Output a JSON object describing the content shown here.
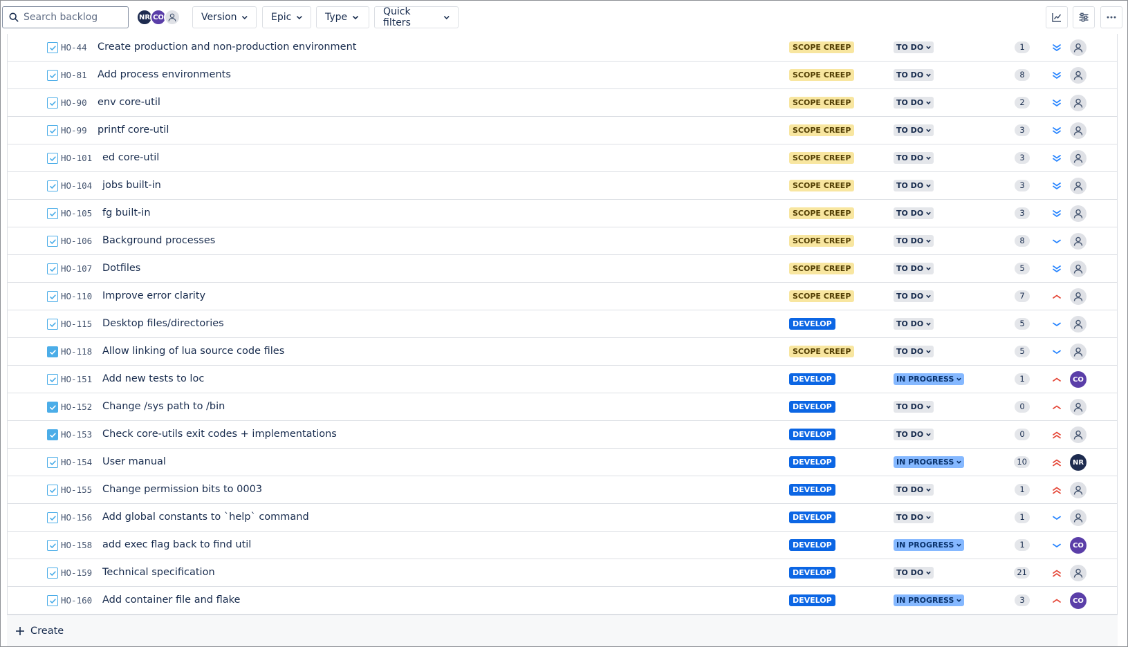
{
  "toolbar": {
    "search_placeholder": "Search backlog",
    "avatars": [
      "NR",
      "CO",
      "unassigned"
    ],
    "filters": {
      "version": "Version",
      "epic": "Epic",
      "type": "Type",
      "quick": "Quick filters"
    },
    "buttons": [
      "insights-icon",
      "view-settings-icon",
      "more-icon"
    ]
  },
  "colors": {
    "scope_creep_bg": "#f8e6a0",
    "develop_bg": "#0c66e4",
    "in_progress_bg": "#85b8ff",
    "todo_bg": "#e4e6ea",
    "priority_low": "#2684ff",
    "priority_high": "#e5493a"
  },
  "issues": [
    {
      "key": "HO-44",
      "summary": "Create production and non-production environment",
      "epic": "SCOPE CREEP",
      "status": "TO DO",
      "points": "1",
      "priority": "lowest",
      "assignee": "",
      "checked": false
    },
    {
      "key": "HO-81",
      "summary": "Add process environments",
      "epic": "SCOPE CREEP",
      "status": "TO DO",
      "points": "8",
      "priority": "lowest",
      "assignee": "",
      "checked": false
    },
    {
      "key": "HO-90",
      "summary": "env core-util",
      "epic": "SCOPE CREEP",
      "status": "TO DO",
      "points": "2",
      "priority": "lowest",
      "assignee": "",
      "checked": false
    },
    {
      "key": "HO-99",
      "summary": "printf core-util",
      "epic": "SCOPE CREEP",
      "status": "TO DO",
      "points": "3",
      "priority": "lowest",
      "assignee": "",
      "checked": false
    },
    {
      "key": "HO-101",
      "summary": "ed core-util",
      "epic": "SCOPE CREEP",
      "status": "TO DO",
      "points": "3",
      "priority": "lowest",
      "assignee": "",
      "checked": false
    },
    {
      "key": "HO-104",
      "summary": "jobs built-in",
      "epic": "SCOPE CREEP",
      "status": "TO DO",
      "points": "3",
      "priority": "lowest",
      "assignee": "",
      "checked": false
    },
    {
      "key": "HO-105",
      "summary": "fg built-in",
      "epic": "SCOPE CREEP",
      "status": "TO DO",
      "points": "3",
      "priority": "lowest",
      "assignee": "",
      "checked": false
    },
    {
      "key": "HO-106",
      "summary": "Background processes",
      "epic": "SCOPE CREEP",
      "status": "TO DO",
      "points": "8",
      "priority": "low",
      "assignee": "",
      "checked": false
    },
    {
      "key": "HO-107",
      "summary": "Dotfiles",
      "epic": "SCOPE CREEP",
      "status": "TO DO",
      "points": "5",
      "priority": "lowest",
      "assignee": "",
      "checked": false
    },
    {
      "key": "HO-110",
      "summary": "Improve error clarity",
      "epic": "SCOPE CREEP",
      "status": "TO DO",
      "points": "7",
      "priority": "high",
      "assignee": "",
      "checked": false
    },
    {
      "key": "HO-115",
      "summary": "Desktop files/directories",
      "epic": "DEVELOP",
      "status": "TO DO",
      "points": "5",
      "priority": "low",
      "assignee": "",
      "checked": false
    },
    {
      "key": "HO-118",
      "summary": "Allow linking of lua source code files",
      "epic": "SCOPE CREEP",
      "status": "TO DO",
      "points": "5",
      "priority": "low",
      "assignee": "",
      "checked": true
    },
    {
      "key": "HO-151",
      "summary": "Add new tests to loc",
      "epic": "DEVELOP",
      "status": "IN PROGRESS",
      "points": "1",
      "priority": "high",
      "assignee": "CO",
      "checked": false
    },
    {
      "key": "HO-152",
      "summary": "Change /sys path to /bin",
      "epic": "DEVELOP",
      "status": "TO DO",
      "points": "0",
      "priority": "high",
      "assignee": "",
      "checked": true
    },
    {
      "key": "HO-153",
      "summary": "Check core-utils exit codes + implementations",
      "epic": "DEVELOP",
      "status": "TO DO",
      "points": "0",
      "priority": "highest",
      "assignee": "",
      "checked": true
    },
    {
      "key": "HO-154",
      "summary": "User manual",
      "epic": "DEVELOP",
      "status": "IN PROGRESS",
      "points": "10",
      "priority": "highest",
      "assignee": "NR",
      "checked": false
    },
    {
      "key": "HO-155",
      "summary": "Change permission bits to 0003",
      "epic": "DEVELOP",
      "status": "TO DO",
      "points": "1",
      "priority": "highest",
      "assignee": "",
      "checked": false
    },
    {
      "key": "HO-156",
      "summary": "Add global constants to `help` command",
      "epic": "DEVELOP",
      "status": "TO DO",
      "points": "1",
      "priority": "low",
      "assignee": "",
      "checked": false
    },
    {
      "key": "HO-158",
      "summary": "add exec flag back to find util",
      "epic": "DEVELOP",
      "status": "IN PROGRESS",
      "points": "1",
      "priority": "low",
      "assignee": "CO",
      "checked": false
    },
    {
      "key": "HO-159",
      "summary": "Technical specification",
      "epic": "DEVELOP",
      "status": "TO DO",
      "points": "21",
      "priority": "highest",
      "assignee": "",
      "checked": false
    },
    {
      "key": "HO-160",
      "summary": "Add container file and flake",
      "epic": "DEVELOP",
      "status": "IN PROGRESS",
      "points": "3",
      "priority": "high",
      "assignee": "CO",
      "checked": false
    }
  ],
  "footer": {
    "create_label": "Create"
  }
}
